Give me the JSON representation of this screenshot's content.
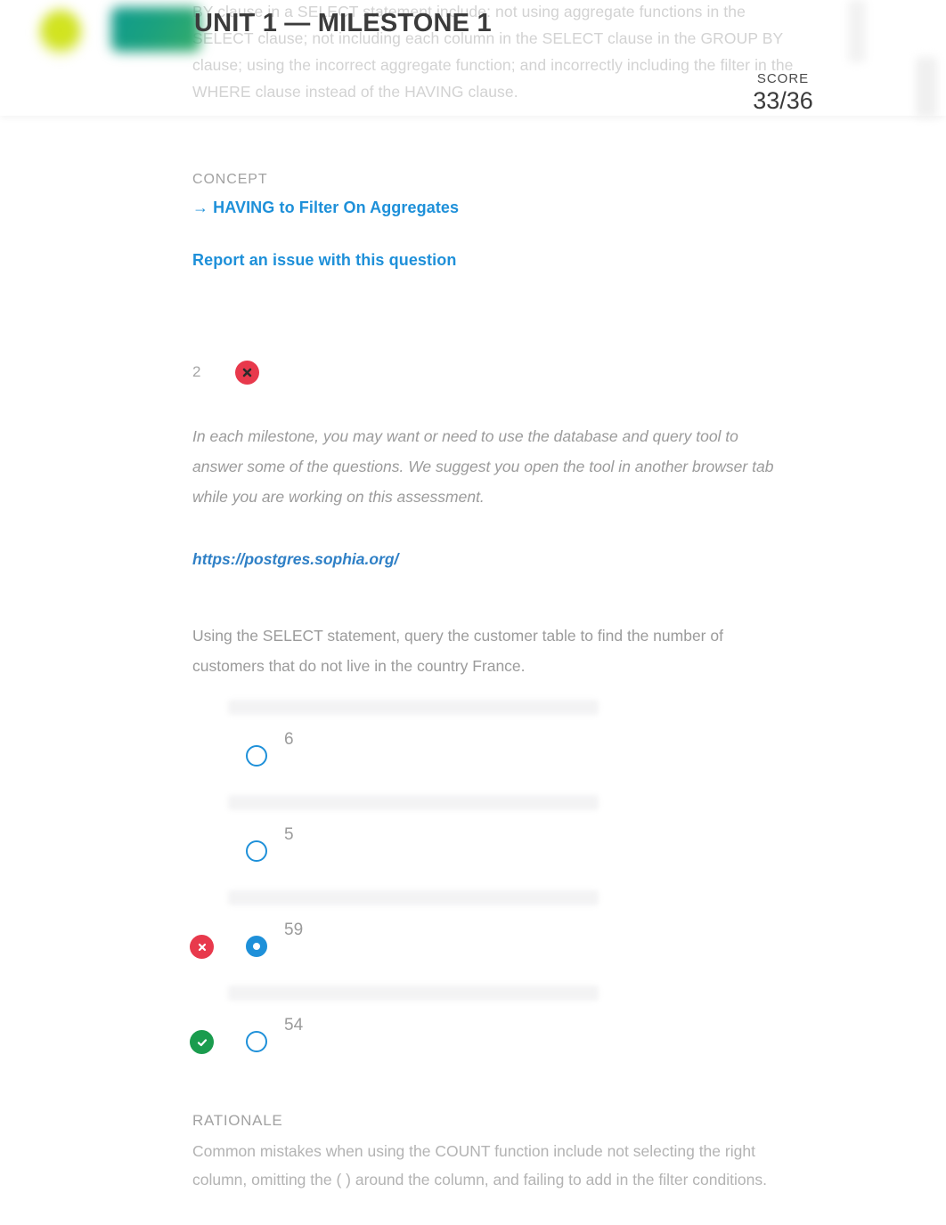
{
  "header": {
    "title": "UNIT 1 — MILESTONE 1",
    "score_label": "SCORE",
    "score_value": "33/36",
    "logo_icon": "sophia-logo-icon",
    "chip_icon": "green-chip-icon"
  },
  "top_paragraph": {
    "text": "BY clause in a SELECT statement include: not using aggregate functions in the SELECT clause; not including each column in the SELECT clause in the GROUP BY clause; using the incorrect aggregate function; and incorrectly including the filter in the WHERE clause instead of the HAVING clause."
  },
  "concept": {
    "label": "CONCEPT",
    "arrow": "→",
    "link_text": "HAVING to Filter On Aggregates"
  },
  "report": {
    "link_text": "Report an issue with this question"
  },
  "question": {
    "number": "2",
    "status_icon": "wrong-x-icon",
    "status": "incorrect",
    "instructions": "In each milestone, you may want or need to use the database and query tool to answer some of the questions. We suggest you open the tool in another browser tab while you are working on this assessment.",
    "tool_url": "https://postgres.sophia.org/",
    "prompt": "Using the SELECT statement, query the customer table to find the number of customers that do not live in the country France.",
    "options": [
      {
        "label": "6",
        "selected": false,
        "marker": "none"
      },
      {
        "label": "5",
        "selected": false,
        "marker": "none"
      },
      {
        "label": "59",
        "selected": true,
        "marker": "wrong"
      },
      {
        "label": "54",
        "selected": false,
        "marker": "correct"
      }
    ]
  },
  "rationale": {
    "title": "RATIONALE",
    "text": "Common mistakes when using the COUNT function include not selecting the right column, omitting the ( ) around the column, and failing to add in the filter conditions."
  },
  "colors": {
    "link_blue": "#1e90d9",
    "wrong_red": "#e8394c",
    "correct_green": "#1a9c4e",
    "body_gray": "#9b9b9b"
  }
}
